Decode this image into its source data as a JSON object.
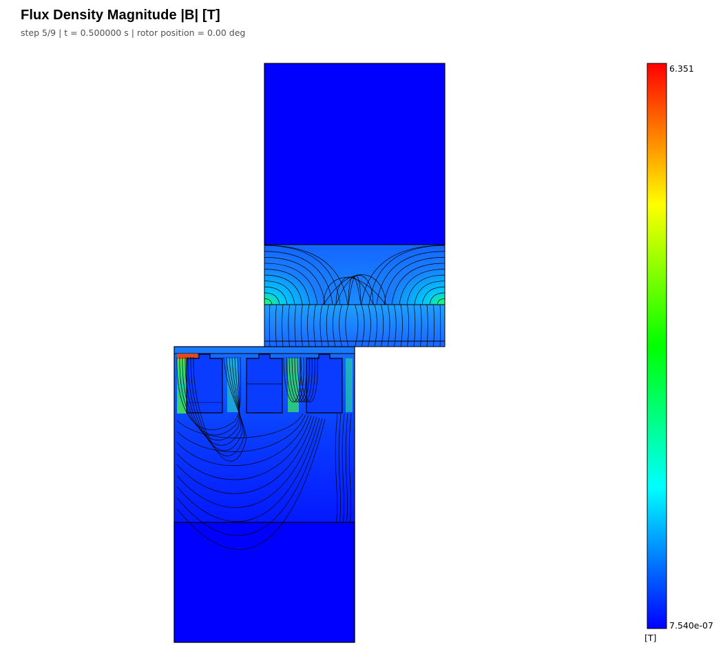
{
  "plot": {
    "title": "Flux Density Magnitude |B|  [T]",
    "subtitle": "step 5/9  |  t = 0.500000 s  |  rotor position = 0.00 deg"
  },
  "colorbar": {
    "max_label": "6.351",
    "min_label": "7.540e-07",
    "unit_label": "[T]",
    "max_value": 6.351,
    "min_value": 7.54e-07,
    "colormap": [
      "#0000ff",
      "#00ffff",
      "#00ff00",
      "#ffff00",
      "#ff0000"
    ]
  },
  "colors": {
    "field_low": "#0000ff",
    "field_mid": "#0a55ff",
    "flux_line": "#000000"
  }
}
